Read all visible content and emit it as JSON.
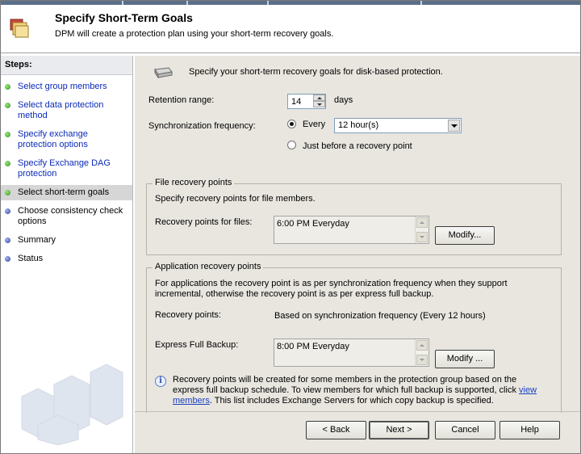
{
  "header": {
    "title": "Specify Short-Term Goals",
    "subtitle": "DPM will create a protection plan using your short-term recovery goals."
  },
  "sidebar": {
    "heading": "Steps:",
    "items": [
      {
        "label": "Select group members",
        "state": "done"
      },
      {
        "label": "Select data protection method",
        "state": "done"
      },
      {
        "label": "Specify exchange protection options",
        "state": "done"
      },
      {
        "label": "Specify Exchange DAG protection",
        "state": "done"
      },
      {
        "label": "Select short-term goals",
        "state": "current"
      },
      {
        "label": "Choose consistency check options",
        "state": "future"
      },
      {
        "label": "Summary",
        "state": "future"
      },
      {
        "label": "Status",
        "state": "future"
      }
    ]
  },
  "main": {
    "intro": "Specify your short-term recovery goals for disk-based protection.",
    "retention_label": "Retention range:",
    "retention_value": "14",
    "retention_unit": "days",
    "sync_label": "Synchronization frequency:",
    "every_label": "Every",
    "every_selected": true,
    "every_value": "12 hour(s)",
    "before_label": "Just before a recovery point",
    "file_group": {
      "title": "File recovery points",
      "description": "Specify recovery points for file members.",
      "points_label": "Recovery points for files:",
      "points_value": "6:00 PM Everyday",
      "modify_label": "Modify..."
    },
    "app_group": {
      "title": "Application recovery points",
      "description": "For applications the recovery point is as per synchronization frequency when they support incremental, otherwise the recovery point is as per express full backup.",
      "points_label": "Recovery points:",
      "points_value": "Based on synchronization frequency (Every 12 hours)",
      "express_label": "Express Full Backup:",
      "express_value": "8:00 PM Everyday",
      "modify_label": "Modify ...",
      "info_part1": "Recovery points will be created for some members in the protection group based on the express full backup schedule. To view members for which full backup is supported, click",
      "info_link": "view members",
      "info_part2": ". This list includes Exchange Servers for which copy backup is specified."
    }
  },
  "footer": {
    "back_label": "< Back",
    "next_label": "Next >",
    "cancel_label": "Cancel",
    "help_label": "Help"
  },
  "colors": {
    "content_bg": "#e8e6df",
    "link": "#0a2ab8",
    "step_done": "#2f9b1f",
    "step_future": "#2c3f9e"
  }
}
